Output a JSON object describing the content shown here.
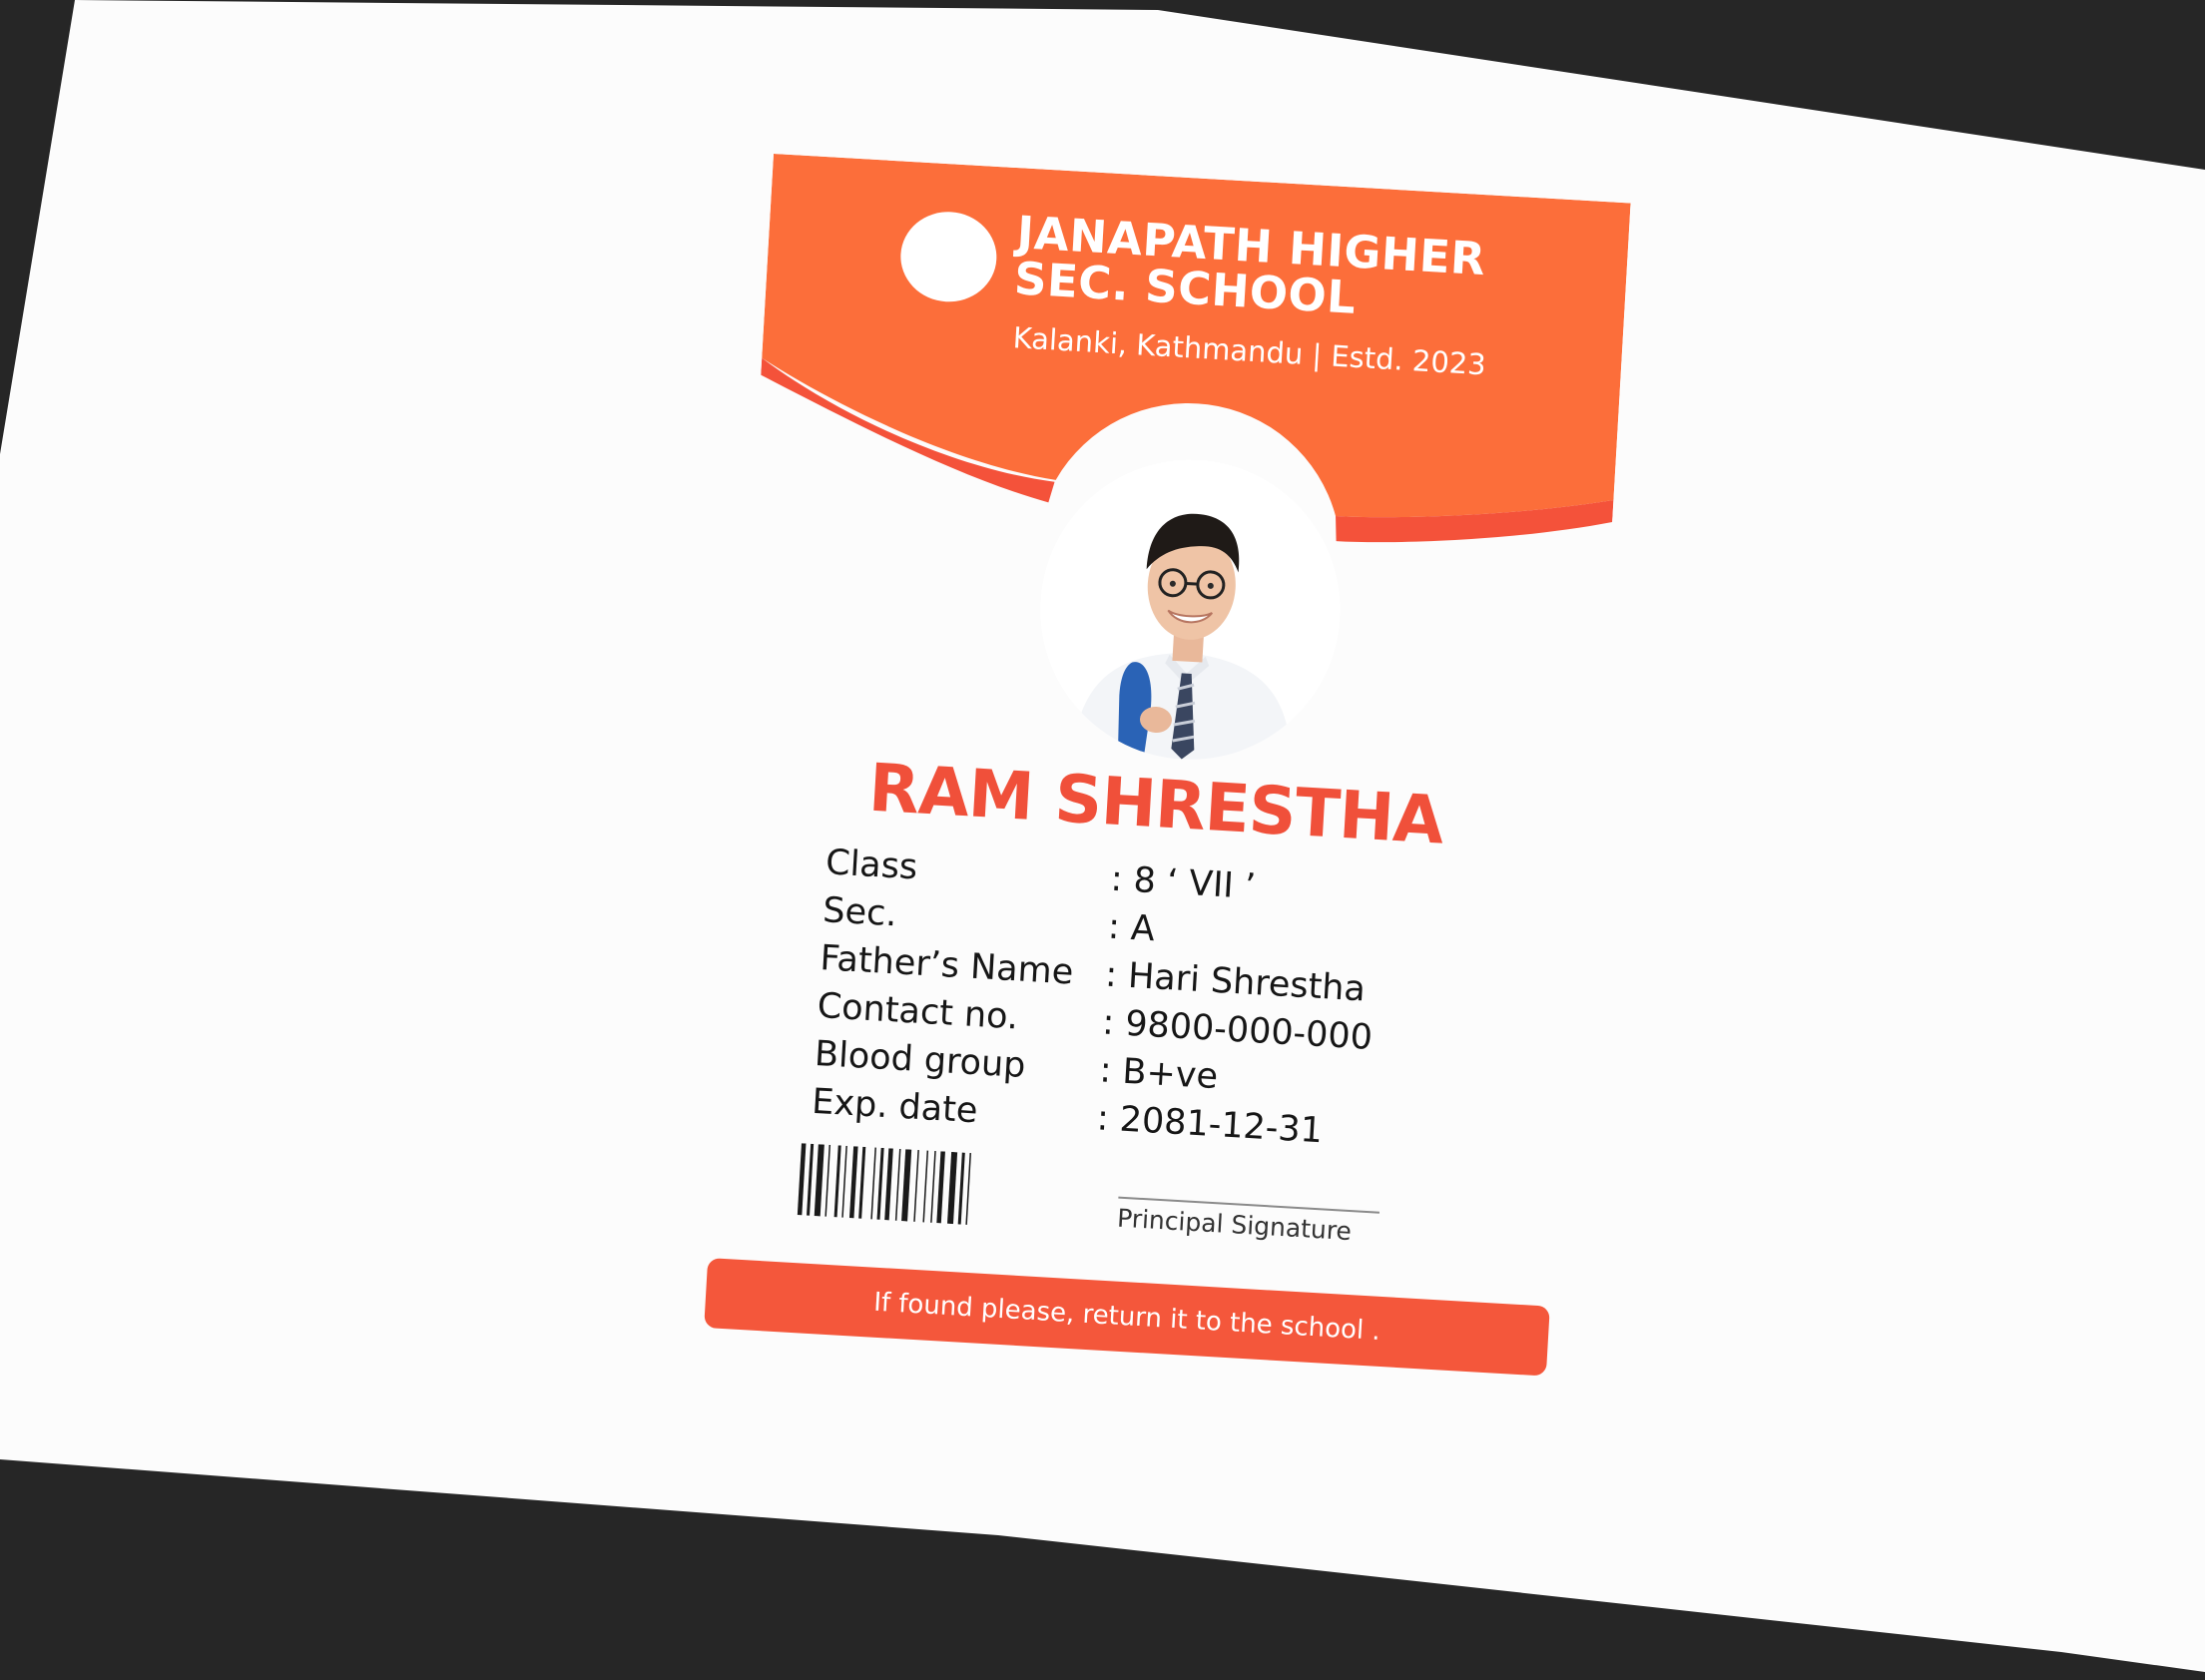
{
  "colors": {
    "background": "#262626",
    "paper": "#fcfcfc",
    "header_orange": "#fc6e3a",
    "header_accent": "#f4523a",
    "name_red": "#f0503a",
    "footer_red": "#f4573b",
    "text_dark": "#161616"
  },
  "school": {
    "name_line1": "JANAPATH HIGHER",
    "name_line2": "SEC. SCHOOL",
    "subtitle": "Kalanki, Kathmandu | Estd. 2023"
  },
  "student": {
    "name": "RAM SHRESTHA"
  },
  "details": [
    {
      "label": "Class",
      "value": "8 ‘ VII ’"
    },
    {
      "label": "Sec.",
      "value": "A"
    },
    {
      "label": "Father’s Name",
      "value": "Hari Shrestha"
    },
    {
      "label": "Contact no.",
      "value": "9800-000-000"
    },
    {
      "label": "Blood group",
      "value": "B+ve"
    },
    {
      "label": "Exp. date",
      "value": "2081-12-31"
    }
  ],
  "signature": {
    "label": "Principal Signature"
  },
  "footer": {
    "text": "If found please, return it to the school ."
  },
  "icons": {
    "logo": "school-logo-placeholder-circle",
    "photo": "student-portrait",
    "barcode": "barcode"
  }
}
